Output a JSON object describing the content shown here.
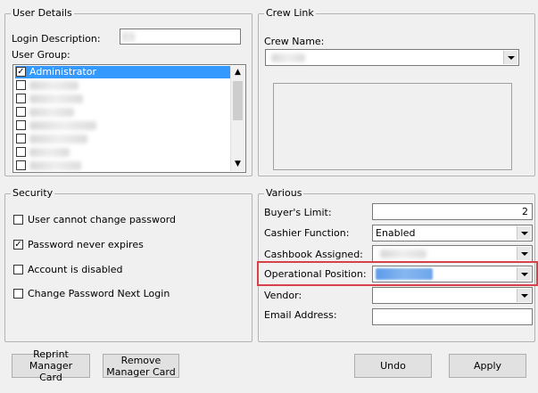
{
  "user_details": {
    "title": "User Details",
    "login_description_label": "Login Description:",
    "user_group_label": "User Group:",
    "groups": [
      {
        "label": "Administrator",
        "checked": true,
        "selected": true
      },
      {
        "label": "",
        "checked": false,
        "selected": false
      },
      {
        "label": "",
        "checked": false,
        "selected": false
      },
      {
        "label": "",
        "checked": false,
        "selected": false
      },
      {
        "label": "",
        "checked": false,
        "selected": false
      },
      {
        "label": "",
        "checked": false,
        "selected": false
      },
      {
        "label": "",
        "checked": false,
        "selected": false
      },
      {
        "label": "",
        "checked": false,
        "selected": false
      }
    ]
  },
  "crew_link": {
    "title": "Crew Link",
    "crew_name_label": "Crew Name:"
  },
  "security": {
    "title": "Security",
    "options": [
      {
        "label": "User cannot change password",
        "checked": false
      },
      {
        "label": "Password never expires",
        "checked": true
      },
      {
        "label": "Account is disabled",
        "checked": false
      },
      {
        "label": "Change Password Next Login",
        "checked": false
      }
    ]
  },
  "various": {
    "title": "Various",
    "buyers_limit_label": "Buyer's Limit:",
    "buyers_limit_value": "2",
    "cashier_function_label": "Cashier Function:",
    "cashier_function_value": "Enabled",
    "cashbook_assigned_label": "Cashbook Assigned:",
    "operational_position_label": "Operational Position:",
    "vendor_label": "Vendor:",
    "email_address_label": "Email Address:"
  },
  "buttons": {
    "reprint_line1": "Reprint Manager",
    "reprint_line2": "Card",
    "remove_line1": "Remove",
    "remove_line2": "Manager Card",
    "undo": "Undo",
    "apply": "Apply"
  },
  "colors": {
    "highlight": "#d9414a",
    "selection": "#3399ff"
  }
}
